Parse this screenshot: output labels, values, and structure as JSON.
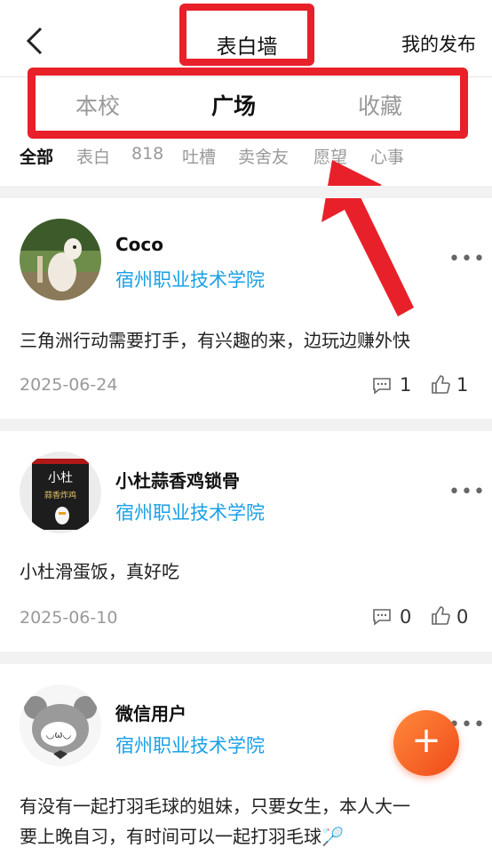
{
  "header": {
    "title": "表白墙",
    "my_posts": "我的发布"
  },
  "scopes": [
    "本校",
    "广场",
    "收藏"
  ],
  "active_scope": "广场",
  "categories": [
    "全部",
    "表白",
    "818",
    "吐槽",
    "卖舍友",
    "愿望",
    "心事"
  ],
  "active_category": "全部",
  "posts": [
    {
      "user": "Coco",
      "school": "宿州职业技术学院",
      "content": "三角洲行动需要打手，有兴趣的来，边玩边赚外快",
      "date": "2025-06-24",
      "comments": "1",
      "likes": "1"
    },
    {
      "user": "小杜蒜香鸡锁骨",
      "school": "宿州职业技术学院",
      "content": "小杜滑蛋饭，真好吃",
      "date": "2025-06-10",
      "comments": "0",
      "likes": "0"
    },
    {
      "user": "微信用户",
      "school": "宿州职业技术学院",
      "content_lines": [
        "有没有一起打羽毛球的姐妹，只要女生，本人大一",
        "要上晚自习，有时间可以一起打羽毛球🏸"
      ]
    }
  ],
  "more_label": "•••",
  "fab_label": "+",
  "colors": {
    "accent": "#1aa0e6",
    "highlight": "#e8202a",
    "fab": "#f5602a"
  }
}
